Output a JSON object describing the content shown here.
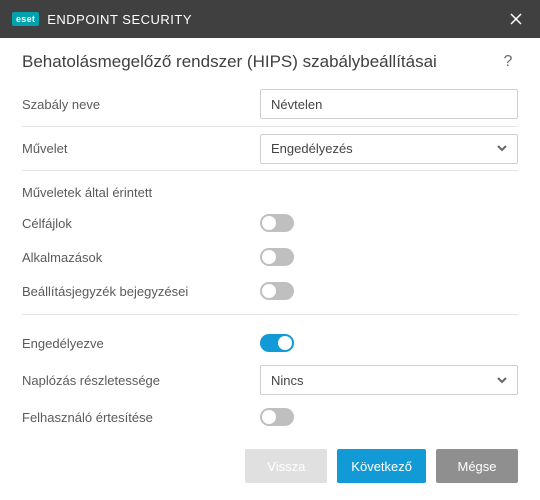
{
  "titlebar": {
    "brand_badge": "eset",
    "brand_main": "ENDPOINT",
    "brand_sub": "SECURITY"
  },
  "header": {
    "title": "Behatolásmegelőző rendszer (HIPS) szabálybeállításai",
    "help": "?"
  },
  "form": {
    "rule_name_label": "Szabály neve",
    "rule_name_value": "Névtelen",
    "action_label": "Művelet",
    "action_value": "Engedélyezés",
    "operations_section": "Műveletek által érintett",
    "target_files_label": "Célfájlok",
    "target_files_on": false,
    "apps_label": "Alkalmazások",
    "apps_on": false,
    "registry_label": "Beállításjegyzék bejegyzései",
    "registry_on": false,
    "enabled_label": "Engedélyezve",
    "enabled_on": true,
    "logging_label": "Naplózás részletessége",
    "logging_value": "Nincs",
    "notify_label": "Felhasználó értesítése",
    "notify_on": false
  },
  "footer": {
    "back": "Vissza",
    "next": "Következő",
    "cancel": "Mégse"
  }
}
